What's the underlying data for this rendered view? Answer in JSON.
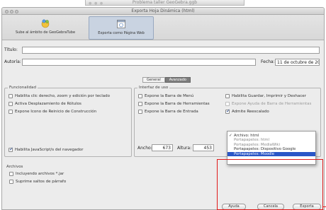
{
  "background_window": {
    "title": "Problema taller GeoGebra.ggb"
  },
  "window": {
    "title": "Exporta Hoja Dinámica (html)"
  },
  "toolbar": {
    "upload_label": "Sube al ámbito de GeoGebraTube",
    "export_label": "Exporta como Página Web"
  },
  "form": {
    "title_label": "Título:",
    "author_label": "Autoría:",
    "title_value": "",
    "author_value": "",
    "date_label": "Fecha:",
    "date_value": "11 de octubre de 201"
  },
  "tabs": [
    {
      "label": "General",
      "selected": false
    },
    {
      "label": "Avanzado",
      "selected": true
    }
  ],
  "funcionalidad": {
    "title": "Funcionalidad",
    "items": [
      {
        "label": "Habilita clic derecho, zoom y edición por teclado",
        "checked": false,
        "enabled": true
      },
      {
        "label": "Activa Desplazamiento de Rótulos",
        "checked": false,
        "enabled": true
      },
      {
        "label": "Expone Icono de Reinicio de Construcción",
        "checked": false,
        "enabled": true
      },
      {
        "label": "Habilita JavaScript/s del navegador",
        "checked": true,
        "enabled": true
      }
    ]
  },
  "interfaz": {
    "title": "Interfaz de uso",
    "col1": [
      {
        "label": "Expone la Barra de Menú",
        "checked": false,
        "enabled": true
      },
      {
        "label": "Expone la Barra de Herramientas",
        "checked": false,
        "enabled": true
      },
      {
        "label": "Expone la Barra de Entrada",
        "checked": false,
        "enabled": true
      }
    ],
    "col2": [
      {
        "label": "Habilita Guardar, Imprimir y Deshacer",
        "checked": false,
        "enabled": true
      },
      {
        "label": "Expone Ayuda de Barra de Herramientas",
        "checked": false,
        "enabled": false
      },
      {
        "label": "Admite Reescalado",
        "checked": true,
        "enabled": true
      }
    ],
    "width_label": "Ancho:",
    "width_value": "673",
    "height_label": "Altura:",
    "height_value": "453"
  },
  "archivos": {
    "title": "Archivos",
    "items": [
      {
        "label": "Incluyendo archivos *.jar",
        "checked": false
      },
      {
        "label": "Suprime saltos de párrafo",
        "checked": false
      }
    ]
  },
  "dropdown": {
    "options": [
      {
        "label": "Archivo: html",
        "checked": true,
        "highlighted": false,
        "dim": false
      },
      {
        "label": "Portapapeles: html",
        "checked": false,
        "highlighted": false,
        "dim": true
      },
      {
        "label": "Portapapeles: MediaWiki",
        "checked": false,
        "highlighted": false,
        "dim": true
      },
      {
        "label": "Portapapeles: Dispositivo Google",
        "checked": false,
        "highlighted": false,
        "dim": false
      },
      {
        "label": "Portapapeles: Moodle",
        "checked": false,
        "highlighted": true,
        "dim": false
      }
    ]
  },
  "buttons": {
    "help": "Ayuda",
    "cancel": "Cancela",
    "export": "Exporta"
  },
  "colors": {
    "highlight": "#2a56c7",
    "annotation": "#e01919",
    "tab_selected": "#7d7d7d"
  }
}
